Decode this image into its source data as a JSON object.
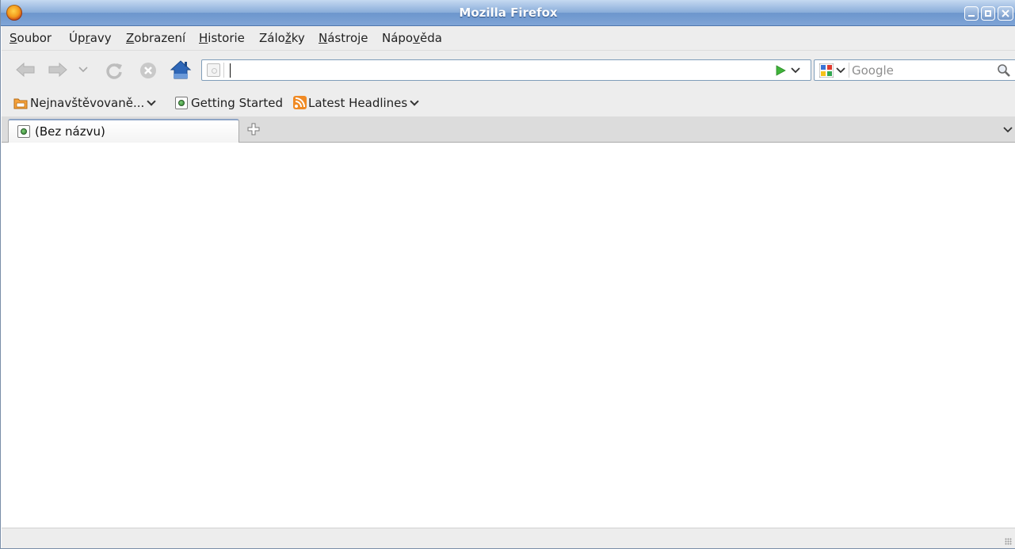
{
  "window": {
    "title": "Mozilla Firefox"
  },
  "menu": {
    "items": [
      {
        "label": "Soubor",
        "accel": "S",
        "rest": "oubor"
      },
      {
        "label": "Úpravy",
        "pre": "Úp",
        "accel": "r",
        "rest": "avy"
      },
      {
        "label": "Zobrazení",
        "accel": "Z",
        "rest": "obrazení"
      },
      {
        "label": "Historie",
        "accel": "H",
        "rest": "istorie"
      },
      {
        "label": "Záložky",
        "pre": "Zálo",
        "accel": "ž",
        "rest": "ky"
      },
      {
        "label": "Nástroje",
        "accel": "N",
        "rest": "ástroje"
      },
      {
        "label": "Nápověda",
        "pre": "Nápo",
        "accel": "v",
        "rest": "ěda"
      }
    ]
  },
  "navbar": {
    "url_value": "",
    "search_placeholder": "Google",
    "buttons": [
      "back-icon",
      "forward-icon",
      "history-dropdown-icon",
      "reload-icon",
      "stop-icon",
      "home-icon",
      "go-icon",
      "search-engine-icon",
      "search-icon"
    ]
  },
  "bookmarks": {
    "items": [
      {
        "label": "Nejnavštěvovaně...",
        "icon": "smart-folder-icon"
      },
      {
        "label": "Getting Started",
        "icon": "page-icon"
      },
      {
        "label": "Latest Headlines",
        "icon": "rss-icon"
      }
    ]
  },
  "tabs": {
    "items": [
      {
        "label": "(Bez názvu)"
      }
    ]
  },
  "colors": {
    "titlebar": "#7fa4d6",
    "chrome": "#ededed",
    "go_arrow": "#3fb33a",
    "home": "#2e67b8",
    "rss": "#f08a24"
  }
}
